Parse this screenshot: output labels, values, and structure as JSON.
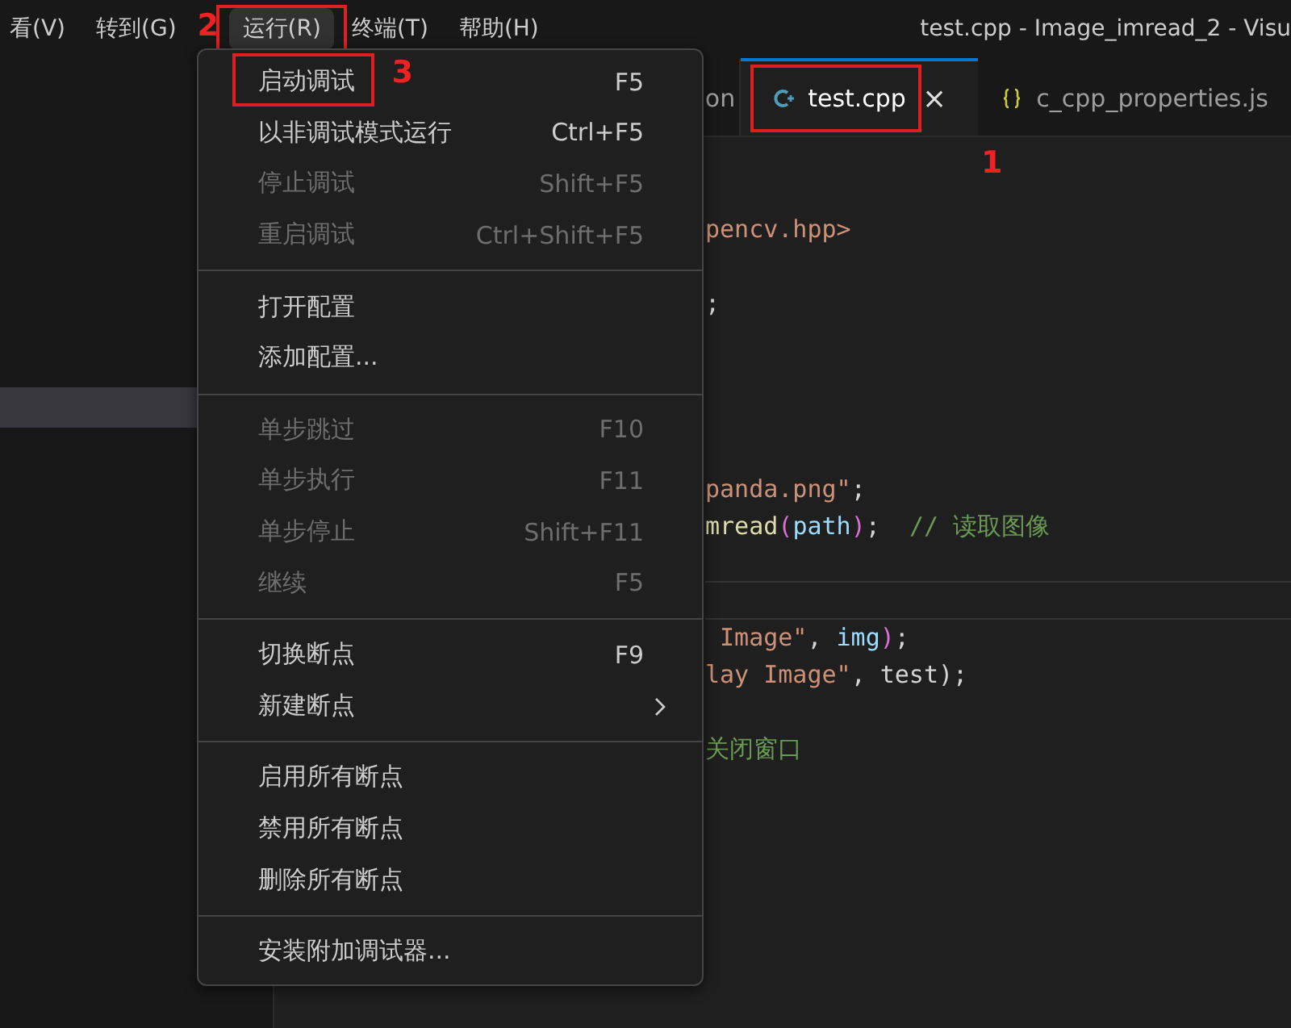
{
  "menubar": {
    "items": [
      {
        "label": "看(V)",
        "selected": false
      },
      {
        "label": "转到(G)",
        "selected": false
      },
      {
        "label": "运行(R)",
        "selected": true,
        "callout": "2"
      },
      {
        "label": "终端(T)",
        "selected": false
      },
      {
        "label": "帮助(H)",
        "selected": false
      }
    ],
    "title": "test.cpp - Image_imread_2 - Visu"
  },
  "tabs": [
    {
      "label": "on",
      "selected": false
    },
    {
      "label": "test.cpp",
      "selected": true,
      "close": "×",
      "callout": "1"
    },
    {
      "label": "c_cpp_properties.js",
      "selected": false
    }
  ],
  "code_lines": [
    {
      "segments": [
        {
          "kind": "string",
          "text": "pencv.hpp>"
        }
      ]
    },
    {
      "segments": [
        {
          "kind": "plain",
          "text": ";"
        }
      ]
    },
    {
      "segments": [
        {
          "kind": "string",
          "text": "panda.png\""
        },
        {
          "kind": "plain",
          "text": ";"
        }
      ]
    },
    {
      "segments": [
        {
          "kind": "func",
          "text": "mread"
        },
        {
          "kind": "paren",
          "text": "("
        },
        {
          "kind": "var",
          "text": "path"
        },
        {
          "kind": "paren",
          "text": ")"
        },
        {
          "kind": "plain",
          "text": ";  "
        },
        {
          "kind": "comment",
          "text": "// 读取图像"
        }
      ]
    },
    {
      "segments": [
        {
          "kind": "string",
          "text": " Image\""
        },
        {
          "kind": "plain",
          "text": ", "
        },
        {
          "kind": "var",
          "text": "img"
        },
        {
          "kind": "paren",
          "text": ")"
        },
        {
          "kind": "plain",
          "text": ";"
        }
      ]
    },
    {
      "segments": [
        {
          "kind": "string",
          "text": "lay Image\""
        },
        {
          "kind": "plain",
          "text": ", test);"
        }
      ]
    },
    {
      "segments": [
        {
          "kind": "comment",
          "text": "关闭窗口"
        }
      ]
    }
  ],
  "menu": {
    "groups": [
      [
        {
          "label": "启动调试",
          "shortcut": "F5",
          "disabled": false,
          "callout": "3"
        },
        {
          "label": "以非调试模式运行",
          "shortcut": "Ctrl+F5",
          "disabled": false
        },
        {
          "label": "停止调试",
          "shortcut": "Shift+F5",
          "disabled": true
        },
        {
          "label": "重启调试",
          "shortcut": "Ctrl+Shift+F5",
          "disabled": true
        }
      ],
      [
        {
          "label": "打开配置",
          "disabled": false
        },
        {
          "label": "添加配置...",
          "disabled": false
        }
      ],
      [
        {
          "label": "单步跳过",
          "shortcut": "F10",
          "disabled": true
        },
        {
          "label": "单步执行",
          "shortcut": "F11",
          "disabled": true
        },
        {
          "label": "单步停止",
          "shortcut": "Shift+F11",
          "disabled": true
        },
        {
          "label": "继续",
          "shortcut": "F5",
          "disabled": true
        }
      ],
      [
        {
          "label": "切换断点",
          "shortcut": "F9",
          "disabled": false
        },
        {
          "label": "新建断点",
          "disabled": false,
          "submenu": true
        }
      ],
      [
        {
          "label": "启用所有断点",
          "disabled": false
        },
        {
          "label": "禁用所有断点",
          "disabled": false
        },
        {
          "label": "删除所有断点",
          "disabled": false
        }
      ],
      [
        {
          "label": "安装附加调试器...",
          "disabled": false
        }
      ]
    ]
  }
}
